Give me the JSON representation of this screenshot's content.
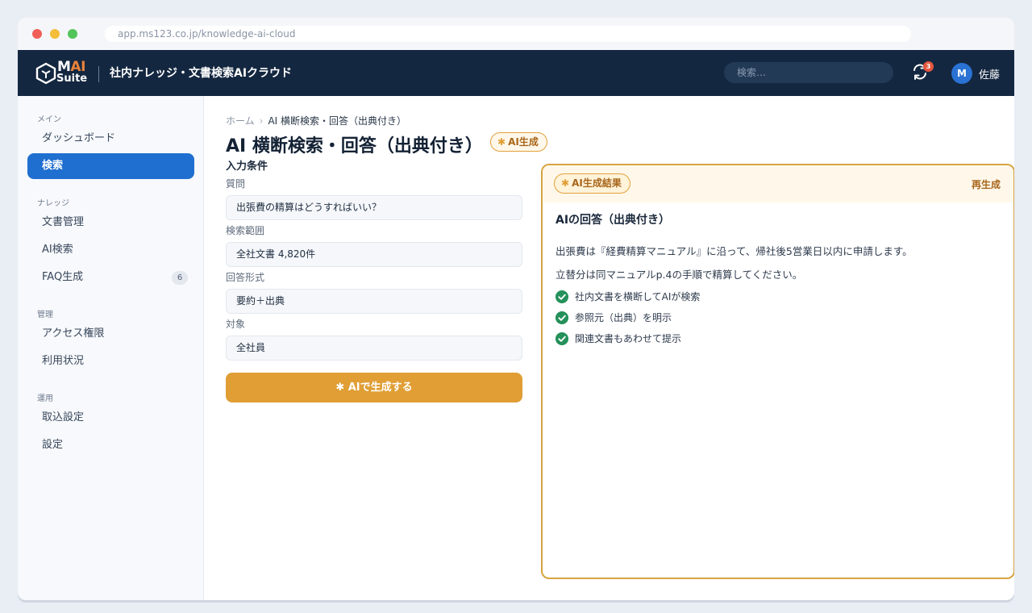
{
  "browser": {
    "url": "app.ms123.co.jp/knowledge-ai-cloud"
  },
  "header": {
    "logo_m": "M",
    "logo_ai": "AI",
    "logo_suite": "Suite",
    "app_title": "社内ナレッジ・文書検索AIクラウド",
    "search_placeholder": "検索…",
    "notification_count": "3",
    "avatar_initial": "M",
    "user_name": "佐藤"
  },
  "sidebar": {
    "sections": [
      {
        "label": "メイン",
        "items": [
          {
            "label": "ダッシュボード"
          },
          {
            "label": "検索",
            "active": true
          }
        ]
      },
      {
        "label": "ナレッジ",
        "items": [
          {
            "label": "文書管理"
          },
          {
            "label": "AI検索"
          },
          {
            "label": "FAQ生成",
            "count": "6"
          }
        ]
      },
      {
        "label": "管理",
        "items": [
          {
            "label": "アクセス権限"
          },
          {
            "label": "利用状況"
          }
        ]
      },
      {
        "label": "運用",
        "items": [
          {
            "label": "取込設定"
          },
          {
            "label": "設定"
          }
        ]
      }
    ]
  },
  "breadcrumb": {
    "home": "ホーム",
    "separator": "›",
    "current": "AI 横断検索・回答（出典付き）"
  },
  "page": {
    "title": "AI 横断検索・回答（出典付き）",
    "ai_badge": "AI生成"
  },
  "form": {
    "section_title": "入力条件",
    "fields": [
      {
        "label": "質問",
        "value": "出張費の精算はどうすればいい？"
      },
      {
        "label": "検索範囲",
        "value": "全社文書 4,820件"
      },
      {
        "label": "回答形式",
        "value": "要約＋出典"
      },
      {
        "label": "対象",
        "value": "全社員"
      }
    ],
    "generate_button": "AIで生成する"
  },
  "result": {
    "badge": "AI生成結果",
    "regenerate": "再生成",
    "title": "AIの回答（出典付き）",
    "paragraphs": [
      "出張費は『経費精算マニュアル』に沿って、帰社後5営業日以内に申請します。",
      "立替分は同マニュアルp.4の手順で精算してください。"
    ],
    "checks": [
      "社内文書を横断してAIが検索",
      "参照元（出典）を明示",
      "関連文書もあわせて提示"
    ]
  },
  "colors": {
    "topbar": "#142740",
    "accent_blue": "#1f6fd0",
    "accent_orange": "#e09e34",
    "check_green": "#24915a"
  }
}
